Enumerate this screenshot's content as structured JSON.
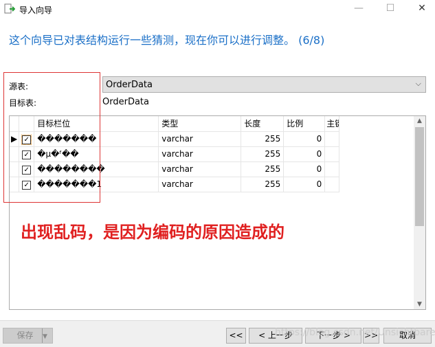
{
  "window": {
    "title": "导入向导"
  },
  "heading": "这个向导已对表结构运行一些猜测，现在你可以进行调整。 (6/8)",
  "source_label": "源表:",
  "target_label": "目标表:",
  "source_value": "OrderData",
  "target_value": "OrderData",
  "grid": {
    "columns": [
      "目标栏位",
      "类型",
      "长度",
      "比例",
      "主键"
    ],
    "rows": [
      {
        "checked": true,
        "name": "�������",
        "type": "varchar",
        "length": "255",
        "scale": "0"
      },
      {
        "checked": true,
        "name": "�µ�ᶠ��",
        "type": "varchar",
        "length": "255",
        "scale": "0"
      },
      {
        "checked": true,
        "name": "��������",
        "type": "varchar",
        "length": "255",
        "scale": "0"
      },
      {
        "checked": true,
        "name": "�������1",
        "type": "varchar",
        "length": "255",
        "scale": "0"
      }
    ]
  },
  "annotation": "出现乱码，是因为编码的原因造成的",
  "footer": {
    "save": "保存",
    "first": "<<",
    "prev": "< 上一步",
    "next": "下一步 >",
    "last": ">>",
    "cancel": "取消"
  },
  "watermark": "https://blog.csdn.net/Unsichtbareit"
}
